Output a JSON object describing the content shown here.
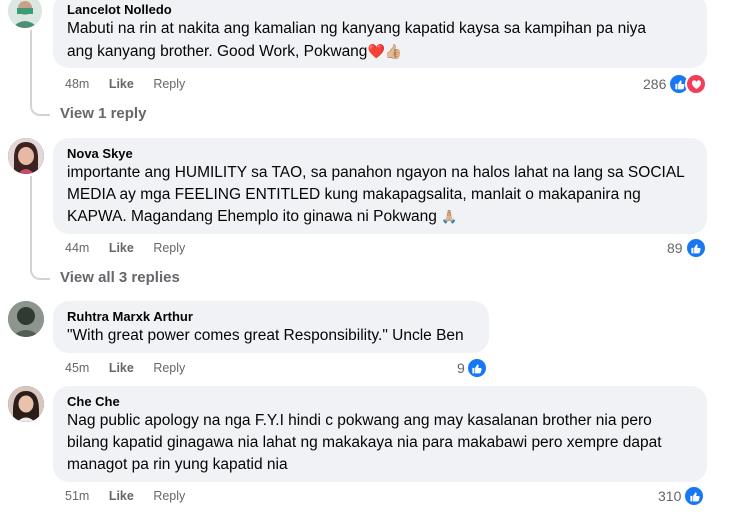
{
  "comments": [
    {
      "author": "Lancelot Nolledo",
      "text_lines": [
        "Mabuti na rin at nakita ang kamalian ng kanyang kapatid kaysa sa kampihan pa niya",
        "ang kanyang brother. Good Work, Pokwang"
      ],
      "emojis": [
        "❤️",
        "👍🏼"
      ],
      "time": "48m",
      "like_label": "Like",
      "reply_label": "Reply",
      "reaction_count": "286",
      "reactions": [
        "like-icon",
        "heart-icon"
      ],
      "view_replies": "View 1 reply"
    },
    {
      "author": "Nova Skye",
      "text_lines": [
        "importante ang HUMILITY sa TAO, sa panahon ngayon na halos lahat na lang sa SOCIAL",
        "MEDIA ay mga FEELING ENTITLED kung makapagsalita, manlait o makapanira ng",
        "KAPWA. Magandang Ehemplo ito ginawa ni Pokwang"
      ],
      "emojis": [
        "🙏🏼"
      ],
      "time": "44m",
      "like_label": "Like",
      "reply_label": "Reply",
      "reaction_count": "89",
      "reactions": [
        "like-icon"
      ],
      "view_replies": "View all 3 replies"
    },
    {
      "author": "Ruhtra Marxk Arthur",
      "text_lines": [
        "\"With great power comes great Responsibility.\" Uncle Ben"
      ],
      "time": "45m",
      "like_label": "Like",
      "reply_label": "Reply",
      "reaction_count": "9",
      "reactions": [
        "like-icon"
      ]
    },
    {
      "author": "Che Che",
      "text_lines": [
        "Nag public apology na nga F.Y.I hindi c pokwang ang may kasalanan brother nia pero",
        "bilang kapatid ginagawa nia lahat ng makakaya nia para makabawi pero xempre dapat",
        "managot pa rin yung kapatid nia"
      ],
      "time": "51m",
      "like_label": "Like",
      "reply_label": "Reply",
      "reaction_count": "310",
      "reactions": [
        "like-icon"
      ]
    }
  ],
  "colors": {
    "like_blue": "#1877f2",
    "heart_red": "#f33e58",
    "bubble": "#f0f2f5",
    "meta": "#65676b"
  }
}
